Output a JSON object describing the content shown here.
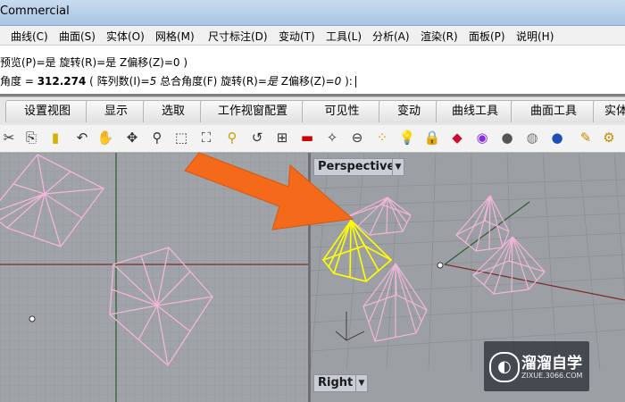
{
  "window": {
    "title": "Commercial"
  },
  "menu": [
    "曲线(C)",
    "曲面(S)",
    "实体(O)",
    "网格(M)",
    "尺寸标注(D)",
    "变动(T)",
    "工具(L)",
    "分析(A)",
    "渲染(R)",
    "面板(P)",
    "说明(H)"
  ],
  "command": {
    "line1": "预览(P)=是  旋转(R)=是  Z偏移(Z)=0 )",
    "line2_prefix": "角度 = ",
    "line2_value": "312.274",
    "line2_mid": " ( 阵列数(I)=",
    "line2_count": "5",
    "line2_rest": "  总合角度(F)  旋转(R)=",
    "line2_rot": "是",
    "line2_end": "  Z偏移(Z)=",
    "line2_z": "0",
    "line2_tail": " ):"
  },
  "tabs": [
    "设置视图",
    "显示",
    "选取",
    "工作视窗配置",
    "可见性",
    "变动",
    "曲线工具",
    "曲面工具",
    "实体"
  ],
  "toolbar_icons": [
    "cut-icon",
    "copy-icon",
    "paste-icon",
    "undo-icon",
    "pan-icon",
    "rotate-view-icon",
    "zoom-icon",
    "zoom-window-icon",
    "zoom-extents-icon",
    "zoom-selected-icon",
    "undo-view-icon",
    "four-viewports-icon",
    "car-icon",
    "mesh-icon",
    "cplane-icon",
    "points-icon",
    "light-icon",
    "lock-icon",
    "layer-icon",
    "color-wheel-icon",
    "material-sphere-icon",
    "render-sphere-icon",
    "blue-sphere-icon",
    "pen-icon",
    "gear-icon"
  ],
  "viewports": {
    "perspective": "Perspective",
    "right": "Right"
  },
  "colors": {
    "wire": "#f2b6da",
    "selected": "#ffff00",
    "arrow": "#f46a1a",
    "grid_bg": "#a0a3a8"
  },
  "watermark": {
    "name": "溜溜自学",
    "url": "ZIXUE.3066.COM"
  }
}
